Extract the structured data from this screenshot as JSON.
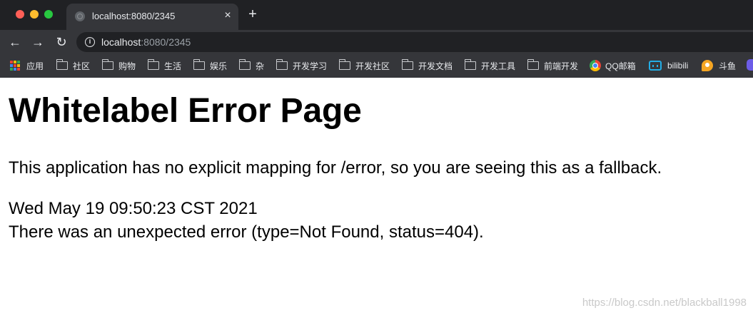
{
  "browser": {
    "tab_title": "localhost:8080/2345",
    "tab_close_glyph": "×",
    "new_tab_glyph": "+",
    "url_host": "localhost",
    "url_rest": ":8080/2345",
    "nav": {
      "back_glyph": "←",
      "forward_glyph": "→",
      "reload_glyph": "↻",
      "info_glyph": "i"
    }
  },
  "bookmarks": [
    {
      "label": "应用",
      "icon": "apps-grid-icon"
    },
    {
      "label": "社区",
      "icon": "folder-icon"
    },
    {
      "label": "购物",
      "icon": "folder-icon"
    },
    {
      "label": "生活",
      "icon": "folder-icon"
    },
    {
      "label": "娱乐",
      "icon": "folder-icon"
    },
    {
      "label": "杂",
      "icon": "folder-icon"
    },
    {
      "label": "开发学习",
      "icon": "folder-icon"
    },
    {
      "label": "开发社区",
      "icon": "folder-icon"
    },
    {
      "label": "开发文档",
      "icon": "folder-icon"
    },
    {
      "label": "开发工具",
      "icon": "folder-icon"
    },
    {
      "label": "前端开发",
      "icon": "folder-icon"
    },
    {
      "label": "QQ邮箱",
      "icon": "chrome-icon"
    },
    {
      "label": "bilibili",
      "icon": "bilibili-icon"
    },
    {
      "label": "斗鱼",
      "icon": "douyu-icon"
    }
  ],
  "page": {
    "title": "Whitelabel Error Page",
    "message": "This application has no explicit mapping for /error, so you are seeing this as a fallback.",
    "timestamp": "Wed May 19 09:50:23 CST 2021",
    "error": "There was an unexpected error (type=Not Found, status=404).",
    "watermark": "https://blog.csdn.net/blackball1998"
  },
  "colors": {
    "traffic_red": "#ff5f57",
    "traffic_yellow": "#febc2e",
    "traffic_green": "#28c840",
    "chrome_dark": "#202124",
    "toolbar": "#35363a"
  }
}
